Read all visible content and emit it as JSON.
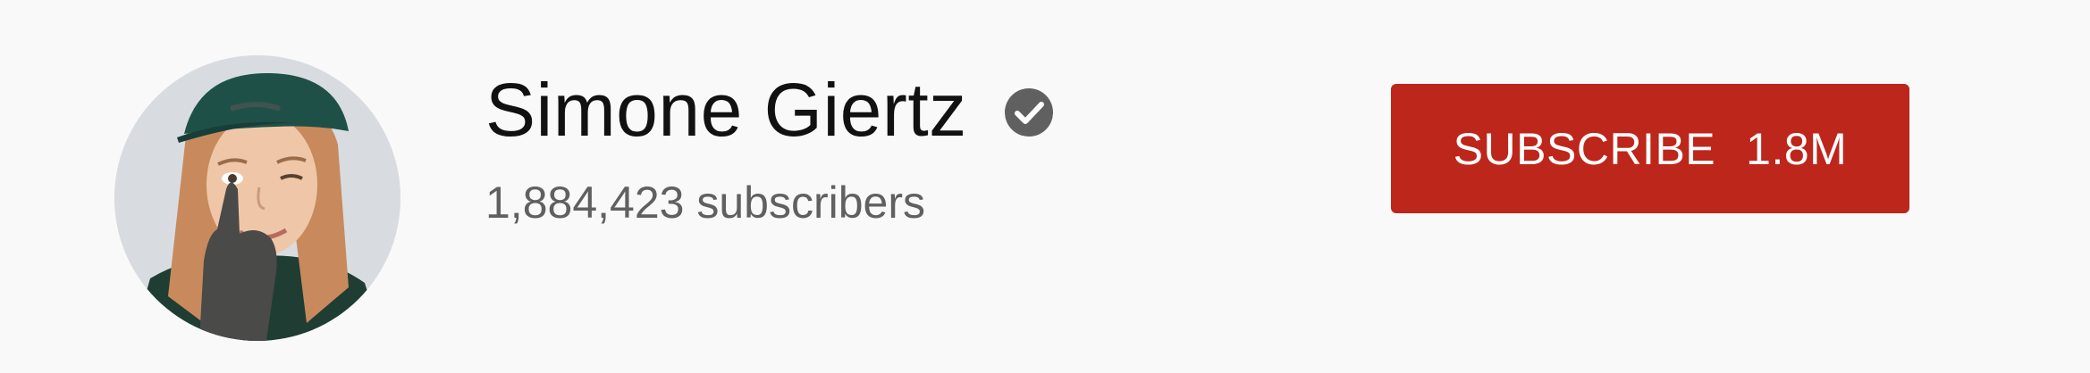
{
  "channel": {
    "name": "Simone Giertz",
    "verified": true,
    "verified_icon": "verified-checkmark-icon",
    "subscriber_text": "1,884,423 subscribers",
    "avatar_image": "channel-avatar-portrait"
  },
  "subscribe_button": {
    "label": "SUBSCRIBE",
    "count": "1.8M"
  },
  "colors": {
    "background": "#f9f9f9",
    "subscribe_red": "#bd261b",
    "name_text": "#111111",
    "secondary_text": "#606060",
    "verified_gray": "#606060"
  }
}
